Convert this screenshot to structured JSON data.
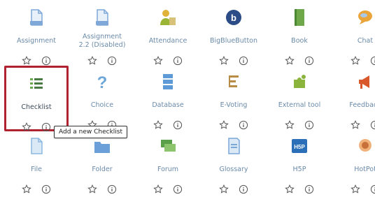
{
  "activities": [
    {
      "name": "Assignment",
      "icon": "assignment-icon",
      "color": "#7fa8d8"
    },
    {
      "name": "Assignment\n2.2 (Disabled)",
      "icon": "assignment-disabled-icon",
      "color": "#7fa8d8"
    },
    {
      "name": "Attendance",
      "icon": "attendance-icon",
      "color": "#9bb537"
    },
    {
      "name": "BigBlueButton",
      "icon": "bigbluebutton-icon",
      "color": "#2b4c86"
    },
    {
      "name": "Book",
      "icon": "book-icon",
      "color": "#6ea84a"
    },
    {
      "name": "Chat",
      "icon": "chat-icon",
      "color": "#e9a43a"
    },
    {
      "name": "Checklist",
      "icon": "checklist-icon",
      "color": "#4a7a44",
      "selected": true
    },
    {
      "name": "Choice",
      "icon": "choice-icon",
      "color": "#6fa6d8"
    },
    {
      "name": "Database",
      "icon": "database-icon",
      "color": "#5e9bd6"
    },
    {
      "name": "E-Voting",
      "icon": "evoting-icon",
      "color": "#b88c44"
    },
    {
      "name": "External tool",
      "icon": "puzzle-icon",
      "color": "#8ab43c"
    },
    {
      "name": "Feedback",
      "icon": "megaphone-icon",
      "color": "#d9582b"
    },
    {
      "name": "File",
      "icon": "file-icon",
      "color": "#8cb8e0"
    },
    {
      "name": "Folder",
      "icon": "folder-icon",
      "color": "#6a9fd8"
    },
    {
      "name": "Forum",
      "icon": "forum-icon",
      "color": "#5aa04a"
    },
    {
      "name": "Glossary",
      "icon": "glossary-icon",
      "color": "#7aa8d8"
    },
    {
      "name": "H5P",
      "icon": "h5p-icon",
      "color": "#2a6fb8"
    },
    {
      "name": "HotPot",
      "icon": "hotpot-icon",
      "color": "#c8703a"
    }
  ],
  "tooltip": "Add a new Checklist",
  "action_icons": [
    "star-icon",
    "info-icon"
  ],
  "action_color": "#555555"
}
